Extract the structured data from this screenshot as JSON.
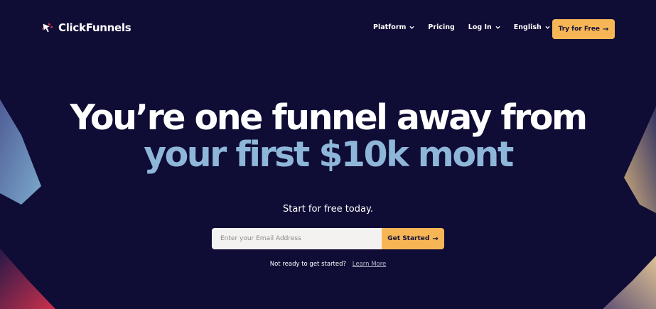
{
  "brand": {
    "name": "ClickFunnels",
    "logo_icon": "clickfunnels-logo-icon"
  },
  "nav": {
    "items": [
      {
        "label": "Platform",
        "dropdown": true
      },
      {
        "label": "Pricing",
        "dropdown": false
      },
      {
        "label": "Log In",
        "dropdown": true
      },
      {
        "label": "English",
        "dropdown": true
      }
    ],
    "cta_label": "Try for Free",
    "cta_icon": "arrow-right-icon"
  },
  "hero": {
    "headline_line1": "You’re one funnel away from",
    "headline_line2": "your first $10k mont",
    "subheading": "Start for free today.",
    "email_placeholder": "Enter your Email Address",
    "submit_label": "Get Started",
    "not_ready_text": "Not ready to get started?",
    "learn_more_label": "Learn More"
  },
  "colors": {
    "background": "#0f0c35",
    "accent": "#f7b656",
    "headline_highlight": "#8eb6d8"
  }
}
